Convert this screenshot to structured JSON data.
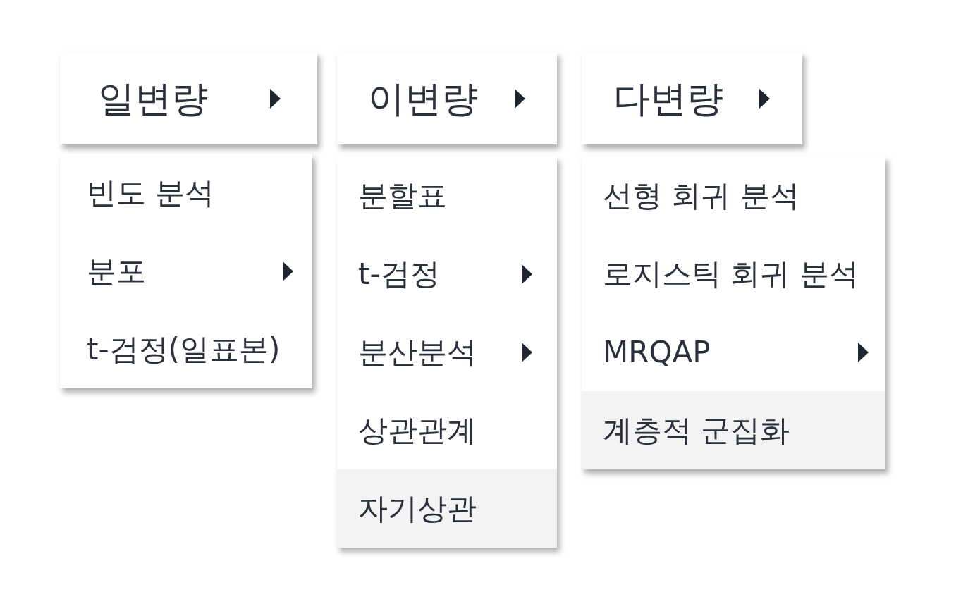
{
  "menus": [
    {
      "label": "일변량",
      "has_submenu": true,
      "items": [
        {
          "label": "빈도 분석",
          "has_submenu": false,
          "selected": false
        },
        {
          "label": "분포",
          "has_submenu": true,
          "selected": false
        },
        {
          "label": "t-검정(일표본)",
          "has_submenu": false,
          "selected": false
        }
      ]
    },
    {
      "label": "이변량",
      "has_submenu": true,
      "items": [
        {
          "label": "분할표",
          "has_submenu": false,
          "selected": false
        },
        {
          "label": "t-검정",
          "has_submenu": true,
          "selected": false
        },
        {
          "label": "분산분석",
          "has_submenu": true,
          "selected": false
        },
        {
          "label": "상관관계",
          "has_submenu": false,
          "selected": false
        },
        {
          "label": "자기상관",
          "has_submenu": false,
          "selected": true
        }
      ]
    },
    {
      "label": "다변량",
      "has_submenu": true,
      "items": [
        {
          "label": "선형 회귀 분석",
          "has_submenu": false,
          "selected": false
        },
        {
          "label": "로지스틱 회귀 분석",
          "has_submenu": false,
          "selected": false
        },
        {
          "label": "MRQAP",
          "has_submenu": true,
          "selected": false
        },
        {
          "label": "계층적 군집화",
          "has_submenu": false,
          "selected": true
        }
      ]
    }
  ]
}
